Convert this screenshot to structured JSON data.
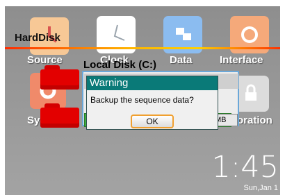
{
  "apps": {
    "source": {
      "label": "Source"
    },
    "clock": {
      "label": "Clock"
    },
    "data": {
      "label": "Data"
    },
    "interface": {
      "label": "Interface"
    },
    "system": {
      "label": "Sys"
    },
    "calibration": {
      "label": "oration"
    }
  },
  "harddisk": {
    "title": "HardDisk"
  },
  "drive": {
    "label": "Local Disk (C:)",
    "free_unit": "MB"
  },
  "dialog": {
    "title": "Warning",
    "message": "Backup the sequence data?",
    "ok_label": "OK"
  },
  "status": {
    "time": "1:45",
    "date": "Sun,Jan 1"
  },
  "colors": {
    "dialog_title_bar": "#0a7a78",
    "folder": "#e30000",
    "ok_focus_border": "#f0a030",
    "rule_gradient_start": "#ff2a00",
    "rule_gradient_mid": "#ffd000"
  }
}
